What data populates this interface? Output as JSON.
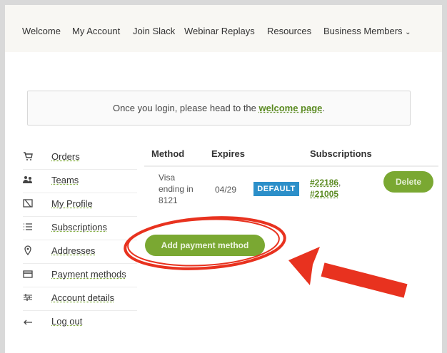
{
  "nav": {
    "items": [
      "Welcome",
      "My Account",
      "Join Slack",
      "Webinar Replays",
      "Resources",
      "Business Members"
    ]
  },
  "notice": {
    "prefix": "Once you login, please head to the ",
    "link": "welcome page",
    "suffix": "."
  },
  "sidebar": {
    "items": [
      {
        "label": "Orders",
        "icon": "cart-icon"
      },
      {
        "label": "Teams",
        "icon": "team-icon"
      },
      {
        "label": "My Profile",
        "icon": "profile-icon"
      },
      {
        "label": "Subscriptions",
        "icon": "list-icon"
      },
      {
        "label": "Addresses",
        "icon": "location-pin-icon"
      },
      {
        "label": "Payment methods",
        "icon": "credit-card-icon"
      },
      {
        "label": "Account details",
        "icon": "sliders-icon"
      },
      {
        "label": "Log out",
        "icon": "logout-arrow-icon"
      }
    ]
  },
  "table": {
    "headers": {
      "method": "Method",
      "expires": "Expires",
      "subscriptions": "Subscriptions"
    },
    "row": {
      "method": [
        "Visa",
        "ending in",
        "8121"
      ],
      "expires": "04/29",
      "badge": "DEFAULT",
      "subscriptions": [
        "#22186",
        "#21005"
      ],
      "delete_label": "Delete"
    }
  },
  "add_payment_label": "Add payment method",
  "colors": {
    "accent": "#7aa832",
    "badge": "#2c8fc9",
    "annotation": "#e8321f"
  }
}
